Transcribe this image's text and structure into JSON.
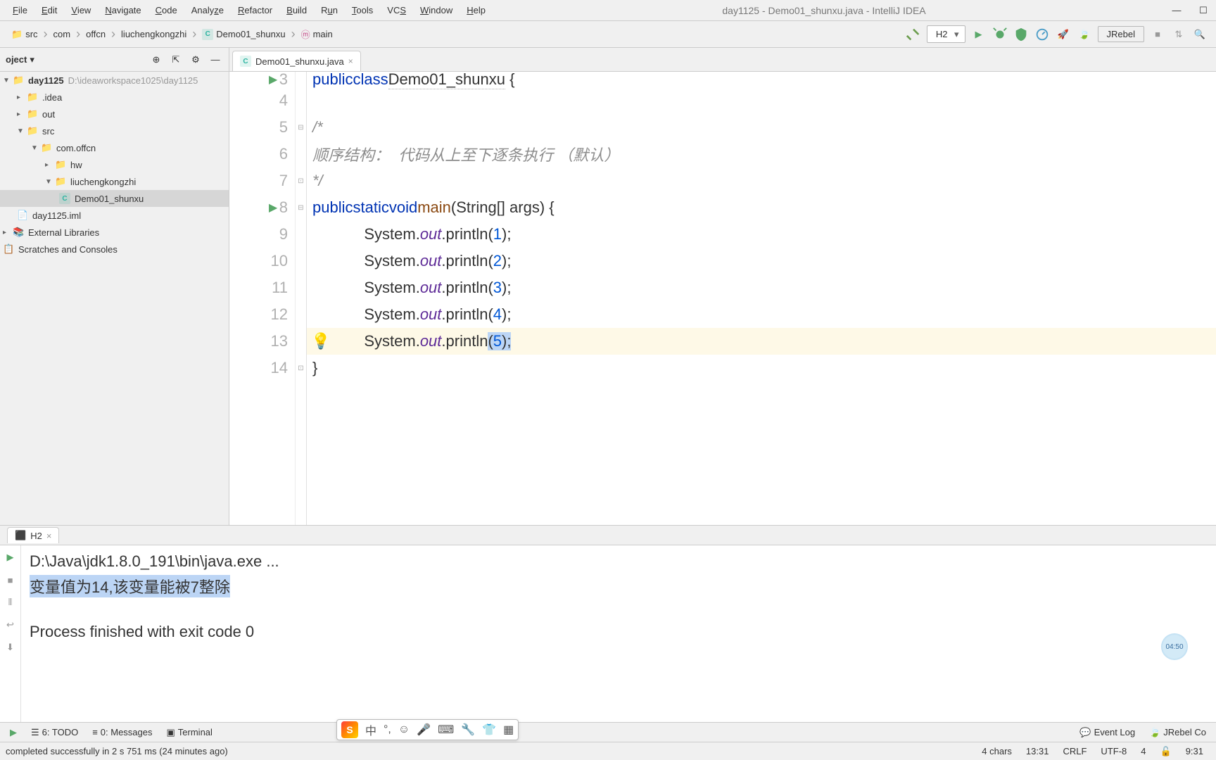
{
  "menu": {
    "file": "File",
    "edit": "Edit",
    "view": "View",
    "navigate": "Navigate",
    "code": "Code",
    "analyze": "Analyze",
    "refactor": "Refactor",
    "build": "Build",
    "run": "Run",
    "tools": "Tools",
    "vcs": "VCS",
    "window": "Window",
    "help": "Help"
  },
  "window_title": "day1125 - Demo01_shunxu.java - IntelliJ IDEA",
  "breadcrumbs": [
    "src",
    "com",
    "offcn",
    "liuchengkongzhi",
    "Demo01_shunxu",
    "main"
  ],
  "run_config": "H2",
  "jrebel_label": "JRebel",
  "project": {
    "title": "oject",
    "root": {
      "name": "day1125",
      "path": "D:\\ideaworkspace1025\\day1125"
    },
    "children": [
      {
        "name": ".idea",
        "indent": 1,
        "icon": "folder"
      },
      {
        "name": "out",
        "indent": 1,
        "icon": "folder-orange"
      },
      {
        "name": "src",
        "indent": 1,
        "icon": "folder-blue",
        "open": true
      },
      {
        "name": "com.offcn",
        "indent": 2,
        "icon": "folder",
        "open": true
      },
      {
        "name": "hw",
        "indent": 3,
        "icon": "folder"
      },
      {
        "name": "liuchengkongzhi",
        "indent": 3,
        "icon": "folder",
        "open": true
      },
      {
        "name": "Demo01_shunxu",
        "indent": 4,
        "icon": "java",
        "selected": true
      },
      {
        "name": "day1125.iml",
        "indent": 1,
        "icon": "file"
      }
    ],
    "ext_lib": "External Libraries",
    "scratches": "Scratches and Consoles"
  },
  "editor_tab": {
    "name": "Demo01_shunxu.java"
  },
  "code": {
    "partial_line": "public class Demo01_shunxu {",
    "l3_num": "3",
    "l4_num": "4",
    "l5_num": "5",
    "l5": "/*",
    "l6_num": "6",
    "l6": "顺序结构：  代码从上至下逐条执行 （默认）",
    "l7_num": "7",
    "l7": "*/",
    "l8_num": "8",
    "l8_kw1": "public",
    "l8_kw2": "static",
    "l8_kw3": "void",
    "l8_fn": "main",
    "l8_rest": "(String[] args) {",
    "l9_num": "9",
    "l10_num": "10",
    "l11_num": "11",
    "l12_num": "12",
    "l13_num": "13",
    "l14_num": "14",
    "sys": "System.",
    "out": "out",
    "print": ".println(",
    "v1": "1",
    "v2": "2",
    "v3": "3",
    "v4": "4",
    "v5": "5",
    "close": ");",
    "brace": "}"
  },
  "run_panel": {
    "tab": "H2",
    "cmd": "D:\\Java\\jdk1.8.0_191\\bin\\java.exe ...",
    "out1": "变量值为14,该变量能被7整除",
    "exit": "Process finished with exit code 0"
  },
  "bottom_tabs": {
    "run": "Run",
    "todo": "6: TODO",
    "messages": "0: Messages",
    "terminal": "Terminal",
    "eventlog": "Event Log",
    "jrebel": "JRebel Co"
  },
  "status": {
    "build": "completed successfully in 2 s 751 ms (24 minutes ago)",
    "chars": "4 chars",
    "pos": "13:31",
    "sep": "CRLF",
    "enc": "UTF-8",
    "spaces": "4",
    "time": "9:31"
  },
  "badge": "04:50"
}
